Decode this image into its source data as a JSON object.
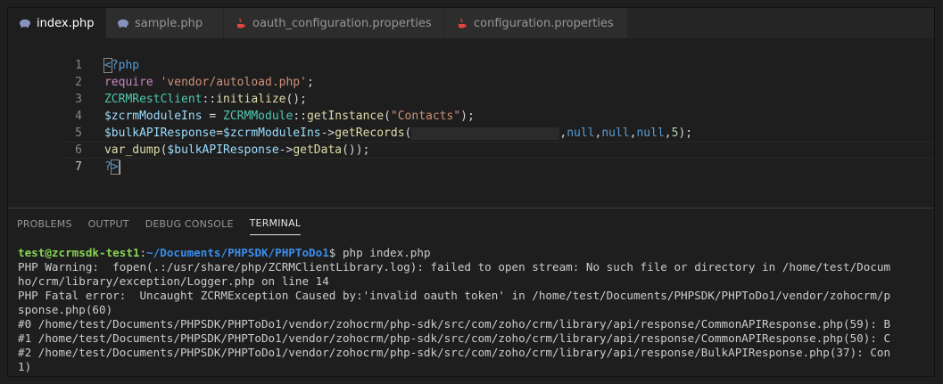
{
  "tabs": [
    {
      "label": "index.php",
      "icon": "php-elephant-icon",
      "active": true,
      "close": "×"
    },
    {
      "label": "sample.php",
      "icon": "php-elephant-icon",
      "active": false
    },
    {
      "label": "oauth_configuration.properties",
      "icon": "java-cup-icon",
      "active": false
    },
    {
      "label": "configuration.properties",
      "icon": "java-cup-icon",
      "active": false
    }
  ],
  "editor": {
    "line_numbers": [
      "1",
      "2",
      "3",
      "4",
      "5",
      "6",
      "7"
    ],
    "l1": {
      "open": "<",
      "rest": "?php"
    },
    "l2": {
      "kw": "require",
      "sp": " ",
      "str": "'vendor/autoload.php'",
      "end": ";"
    },
    "l3": {
      "cls": "ZCRMRestClient",
      "op": "::",
      "fn": "initialize",
      "end": "();"
    },
    "l4": {
      "var": "$zcrmModuleIns",
      "eq": " = ",
      "cls": "ZCRMModule",
      "op": "::",
      "fn": "getInstance",
      "p1": "(",
      "str": "\"Contacts\"",
      "p2": ");"
    },
    "l5": {
      "var1": "$bulkAPIResponse",
      "eq": "=",
      "var2": "$zcrmModuleIns",
      "arrow": "->",
      "fn": "getRecords",
      "p1": "(",
      "comma1": ",",
      "null1": "null",
      "comma2": ",",
      "null2": "null",
      "comma3": ",",
      "null3": "null",
      "comma4": ",",
      "num": "5",
      "end": ");"
    },
    "l6": {
      "fn": "var_dump",
      "p1": "(",
      "var": "$bulkAPIResponse",
      "arrow": "->",
      "fn2": "getData",
      "end": "());"
    },
    "l7": {
      "q": "?",
      "close": ">"
    }
  },
  "panel": {
    "tabs": [
      "PROBLEMS",
      "OUTPUT",
      "DEBUG CONSOLE",
      "TERMINAL"
    ],
    "active": "TERMINAL"
  },
  "terminal": {
    "prompt_user": "test@zcrmsdk-test1",
    "prompt_colon": ":",
    "prompt_path": "~/Documents/PHPSDK/PHPToDo1",
    "prompt_cmd": "$ php index.php",
    "lines": [
      "PHP Warning:  fopen(.:/usr/share/php/ZCRMClientLibrary.log): failed to open stream: No such file or directory in /home/test/Docum",
      "ho/crm/library/exception/Logger.php on line 14",
      "PHP Fatal error:  Uncaught ZCRMException Caused by:'invalid oauth token' in /home/test/Documents/PHPSDK/PHPToDo1/vendor/zohocrm/p",
      "sponse.php(60)",
      "#0 /home/test/Documents/PHPSDK/PHPToDo1/vendor/zohocrm/php-sdk/src/com/zoho/crm/library/api/response/CommonAPIResponse.php(59): B",
      "#1 /home/test/Documents/PHPSDK/PHPToDo1/vendor/zohocrm/php-sdk/src/com/zoho/crm/library/api/response/CommonAPIResponse.php(50): C",
      "#2 /home/test/Documents/PHPSDK/PHPToDo1/vendor/zohocrm/php-sdk/src/com/zoho/crm/library/api/response/BulkAPIResponse.php(37): Con",
      "1)"
    ]
  }
}
